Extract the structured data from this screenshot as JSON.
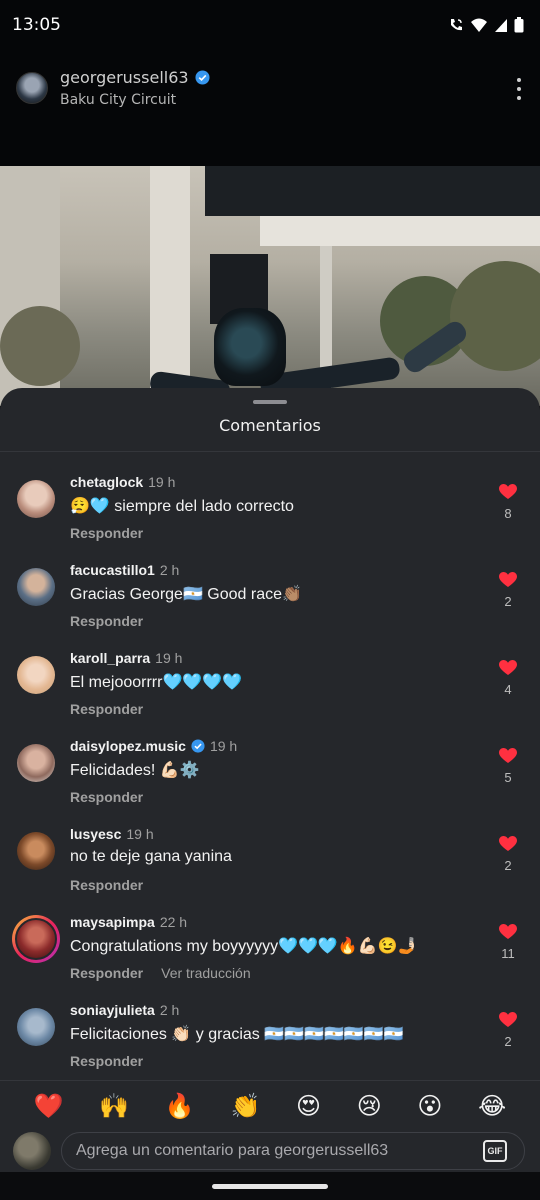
{
  "status_bar": {
    "time": "13:05"
  },
  "post": {
    "username": "georgerussell63",
    "location": "Baku City Circuit"
  },
  "sheet": {
    "title": "Comentarios"
  },
  "comments": [
    {
      "user": "chetaglock",
      "time": "19 h",
      "text": "😮‍💨🩵 siempre del lado correcto",
      "reply": "Responder",
      "likes": "8",
      "avatar_color": "#c9a79a"
    },
    {
      "user": "facucastillo1",
      "time": "2 h",
      "text": "Gracias George🇦🇷 Good race👏🏽",
      "reply": "Responder",
      "likes": "2",
      "avatar_color": "#5b6f86"
    },
    {
      "user": "karoll_parra",
      "time": "19 h",
      "text": "El mejooorrrr🩵🩵🩵🩵",
      "reply": "Responder",
      "likes": "4",
      "avatar_color": "#e9c2a6"
    },
    {
      "user": "daisylopez.music",
      "time": "19 h",
      "text": "Felicidades! 💪🏻⚙️",
      "reply": "Responder",
      "likes": "5",
      "avatar_color": "#b98d7e",
      "verified": true
    },
    {
      "user": "lusyesc",
      "time": "19 h",
      "text": "no te deje gana yanina",
      "reply": "Responder",
      "likes": "2",
      "avatar_color": "#7d4a2a"
    },
    {
      "user": "maysapimpa",
      "time": "22 h",
      "text": "Congratulations my boyyyyyy🩵🩵🩵🔥💪🏻😉🤳🏻",
      "reply": "Responder",
      "translate": "Ver traducción",
      "likes": "11",
      "avatar_color": "#8c2b2b"
    },
    {
      "user": "soniayjulieta",
      "time": "2 h",
      "text": "Felicitaciones 👏🏻 y gracias 🇦🇷🇦🇷🇦🇷🇦🇷🇦🇷🇦🇷🇦🇷",
      "reply": "Responder",
      "likes": "2",
      "avatar_color": "#6d89a6"
    }
  ],
  "emoji_bar": [
    "❤️",
    "🙌",
    "🔥",
    "👏",
    "😍",
    "😢",
    "😮",
    "😂"
  ],
  "composer": {
    "placeholder": "Agrega un comentario para georgerussell63",
    "gif_label": "GIF"
  },
  "colors": {
    "like_red": "#ff3040",
    "verified_blue": "#3797f0",
    "sheet_bg": "#25272b"
  }
}
